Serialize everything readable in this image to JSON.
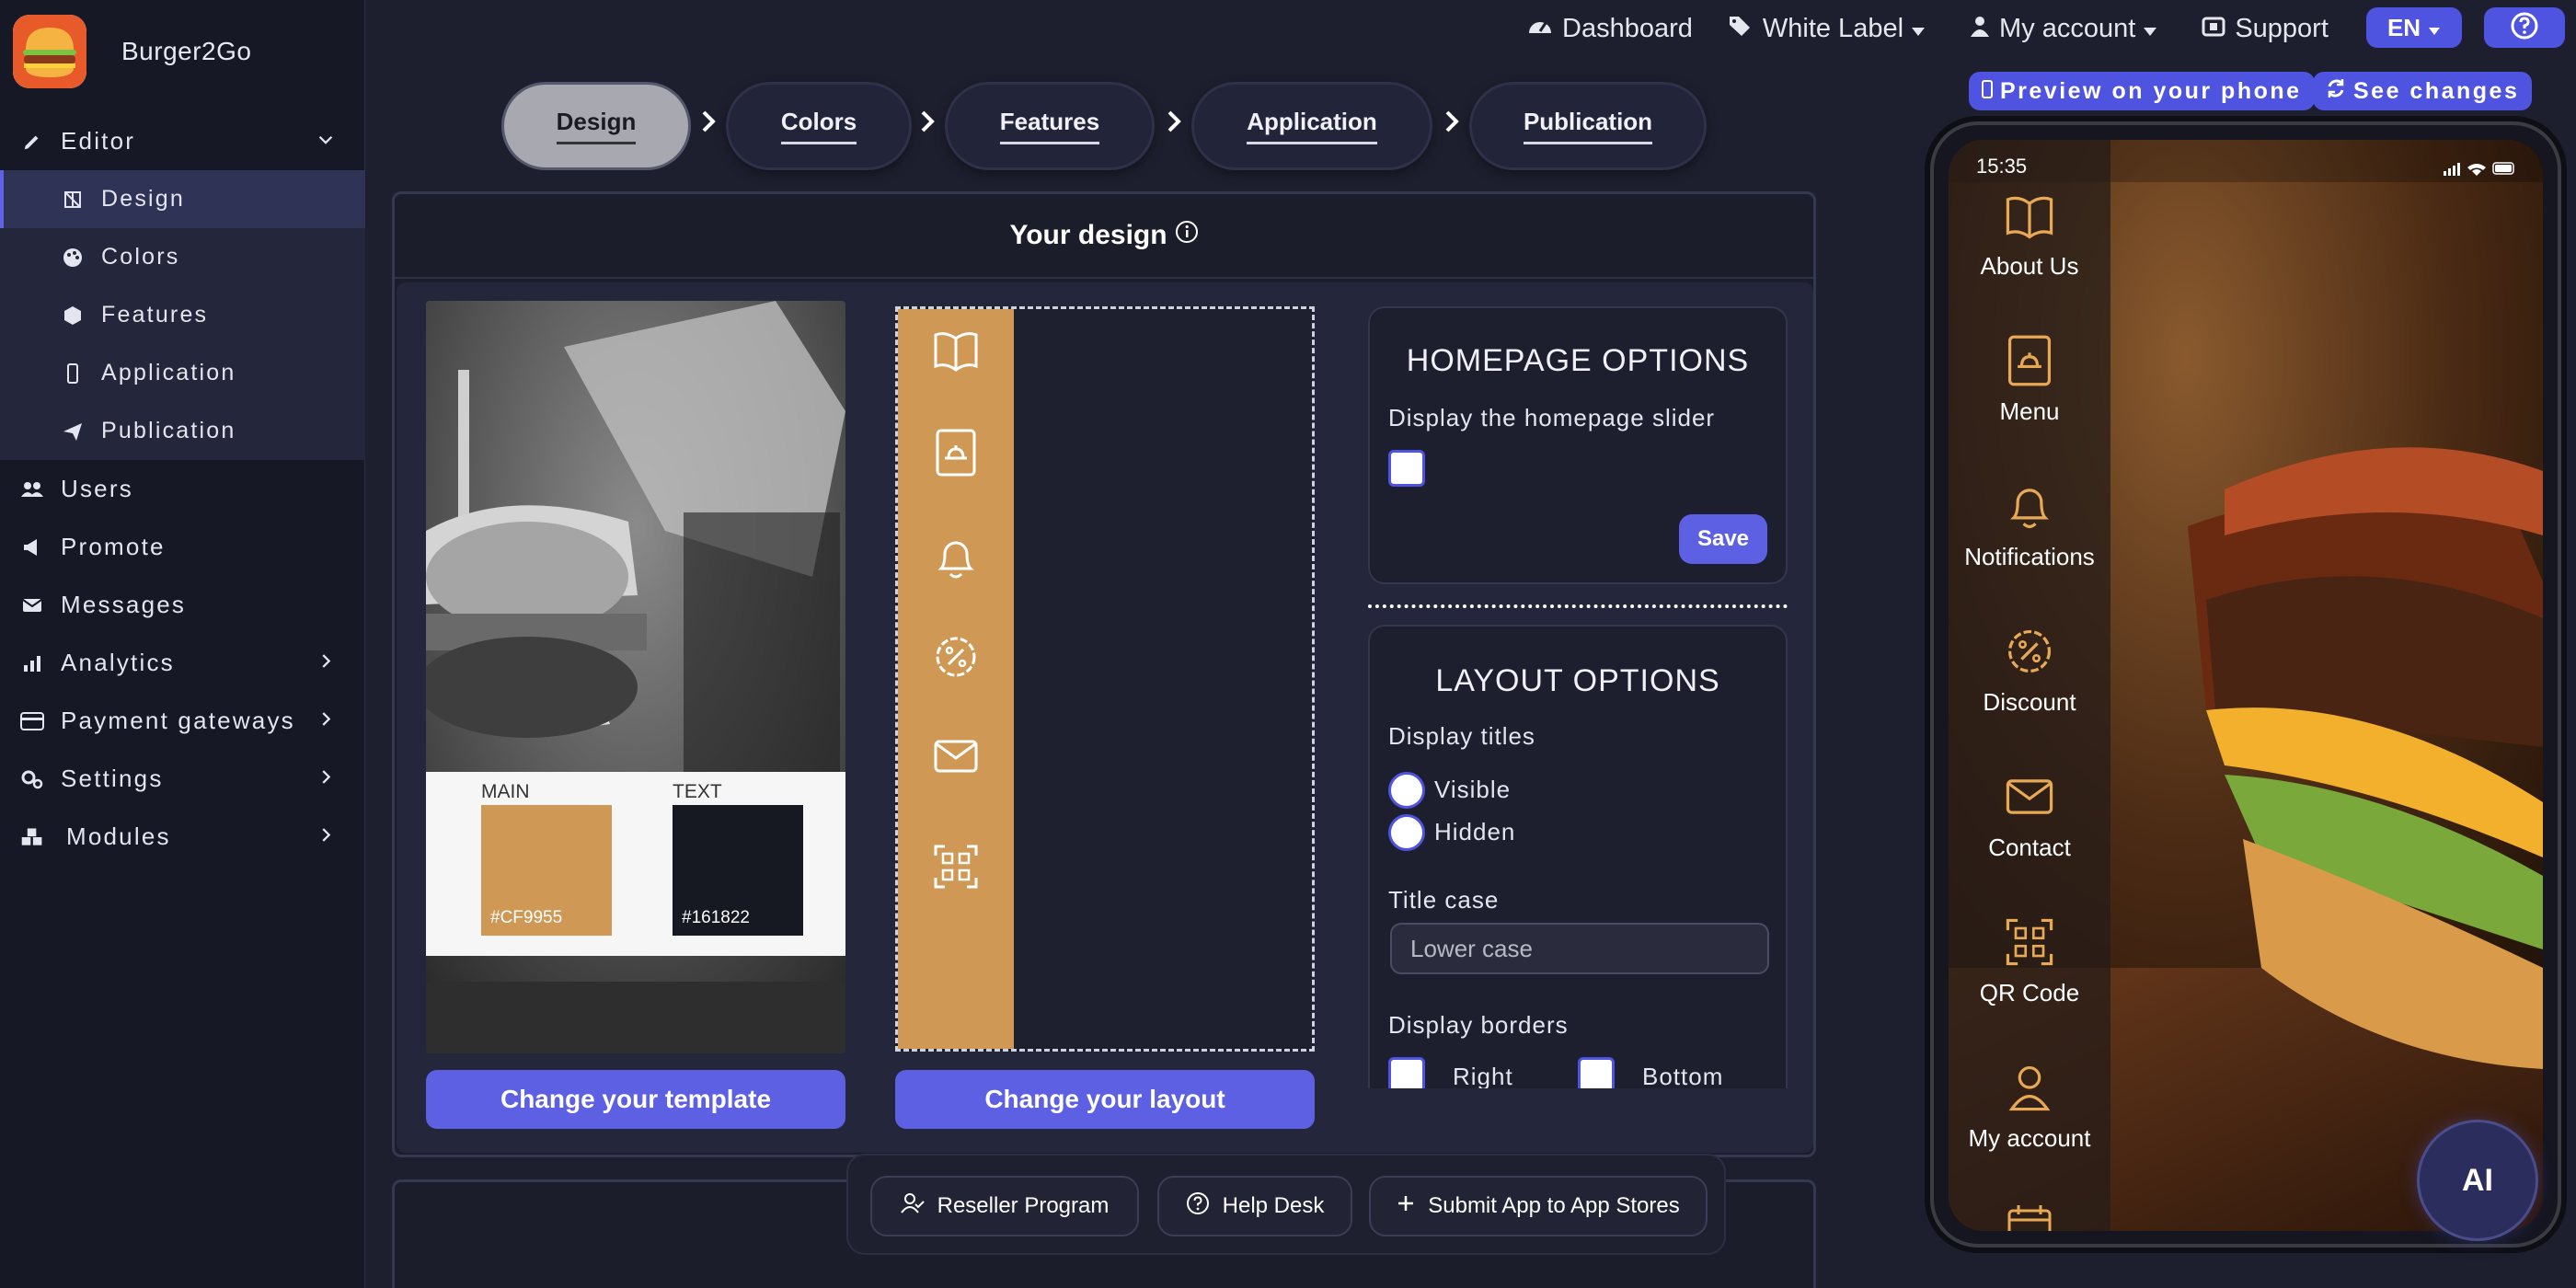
{
  "app": {
    "name": "Burger2Go"
  },
  "sidebar": {
    "editor_label": "Editor",
    "editor_items": [
      {
        "label": "Design"
      },
      {
        "label": "Colors"
      },
      {
        "label": "Features"
      },
      {
        "label": "Application"
      },
      {
        "label": "Publication"
      }
    ],
    "items": [
      {
        "label": "Users"
      },
      {
        "label": "Promote"
      },
      {
        "label": "Messages"
      },
      {
        "label": "Analytics"
      },
      {
        "label": "Payment gateways"
      },
      {
        "label": "Settings"
      },
      {
        "label": "Modules"
      }
    ]
  },
  "topnav": {
    "dashboard": "Dashboard",
    "white_label": "White Label",
    "my_account": "My account",
    "support": "Support",
    "lang": "EN"
  },
  "preview": {
    "phone_label": "Preview on your phone",
    "see_changes": "See changes"
  },
  "steps": [
    "Design",
    "Colors",
    "Features",
    "Application",
    "Publication"
  ],
  "design": {
    "title": "Your design",
    "swatch_main_label": "MAIN",
    "swatch_text_label": "TEXT",
    "main_color": "#CF9955",
    "text_color": "#161822",
    "change_template": "Change your template",
    "change_layout": "Change your layout"
  },
  "homepage_options": {
    "title": "HOMEPAGE OPTIONS",
    "slider_label": "Display the homepage slider",
    "save": "Save"
  },
  "layout_options": {
    "title": "LAYOUT OPTIONS",
    "display_titles_label": "Display titles",
    "visible": "Visible",
    "hidden": "Hidden",
    "title_case_label": "Title case",
    "title_case_value": "Lower case",
    "display_borders_label": "Display borders",
    "right": "Right",
    "bottom": "Bottom"
  },
  "bottombar": {
    "reseller": "Reseller Program",
    "helpdesk": "Help Desk",
    "submit": "Submit App to App Stores"
  },
  "phone": {
    "time": "15:35",
    "menu": [
      "About Us",
      "Menu",
      "Notifications",
      "Discount",
      "Contact",
      "QR Code",
      "My account"
    ]
  },
  "ai": "AI",
  "colors": {
    "accent": "#5d60e3",
    "main": "#cf9955",
    "bg": "#1d1f2e"
  }
}
